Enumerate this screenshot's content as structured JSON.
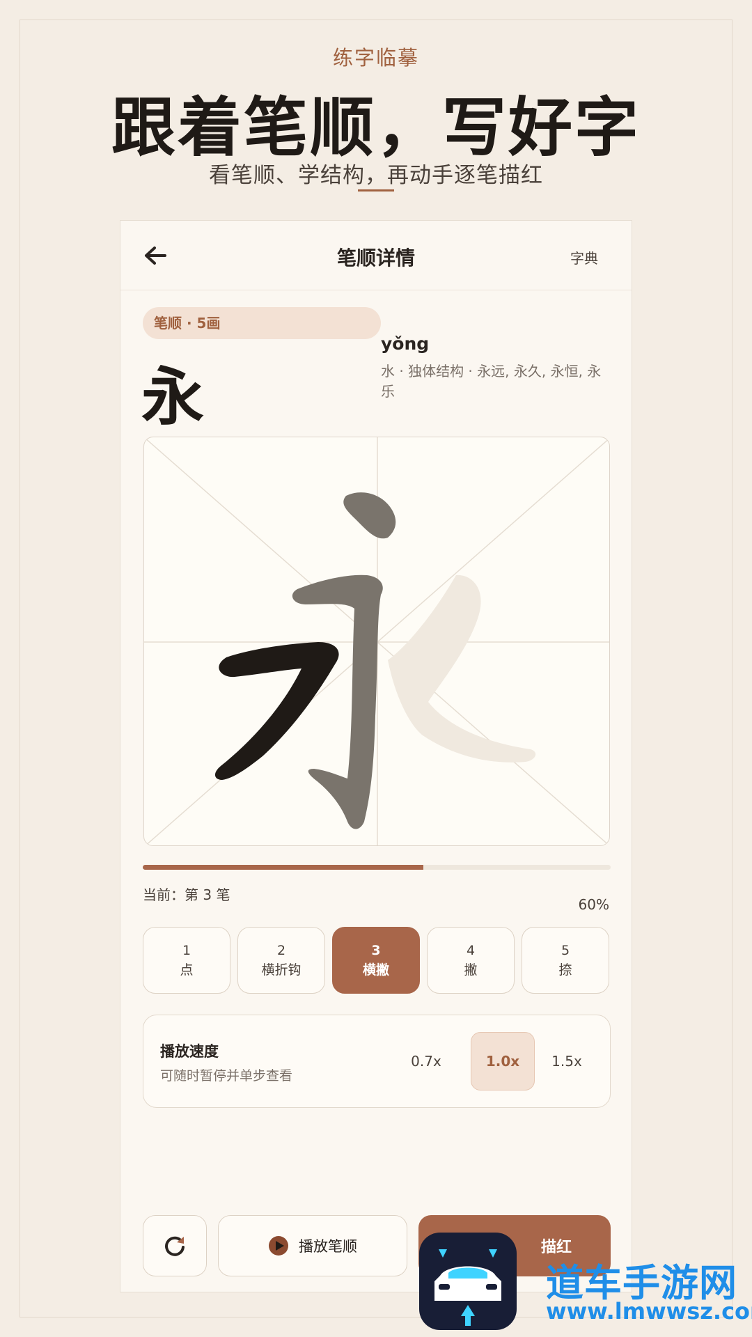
{
  "hero": {
    "eyebrow": "练字临摹",
    "title": "跟着笔顺，写好字",
    "subtitle": "看笔顺、学结构，再动手逐笔描红"
  },
  "header": {
    "back_icon": "arrow-left-icon",
    "title": "笔顺详情",
    "right_link": "字典"
  },
  "character": {
    "badge": "笔顺 · 5画",
    "char": "永",
    "pinyin": "yǒng",
    "info": "水 · 独体结构 · 永远, 永久, 永恒, 永乐",
    "grid_char": "永"
  },
  "progress": {
    "fraction": 0.6,
    "current_label": "当前：第 3 笔",
    "percent_label": "60%"
  },
  "strokes": [
    {
      "num": "1",
      "name": "点",
      "active": false
    },
    {
      "num": "2",
      "name": "横折钩",
      "active": false
    },
    {
      "num": "3",
      "name": "横撇",
      "active": true
    },
    {
      "num": "4",
      "name": "撇",
      "active": false
    },
    {
      "num": "5",
      "name": "捺",
      "active": false
    }
  ],
  "speed": {
    "title": "播放速度",
    "desc": "可随时暂停并单步查看",
    "options": [
      "0.7x",
      "1.0x",
      "1.5x"
    ],
    "selected": "1.0x"
  },
  "actions": {
    "reset_icon": "refresh-icon",
    "play_icon": "play-icon",
    "play_label": "播放笔顺",
    "trace_label": "描红"
  },
  "watermark": {
    "name": "道车手游网",
    "url": "www.lmwwsz.com"
  },
  "colors": {
    "accent": "#a8664a",
    "background": "#f4ede4",
    "card": "#fbf7f1"
  }
}
